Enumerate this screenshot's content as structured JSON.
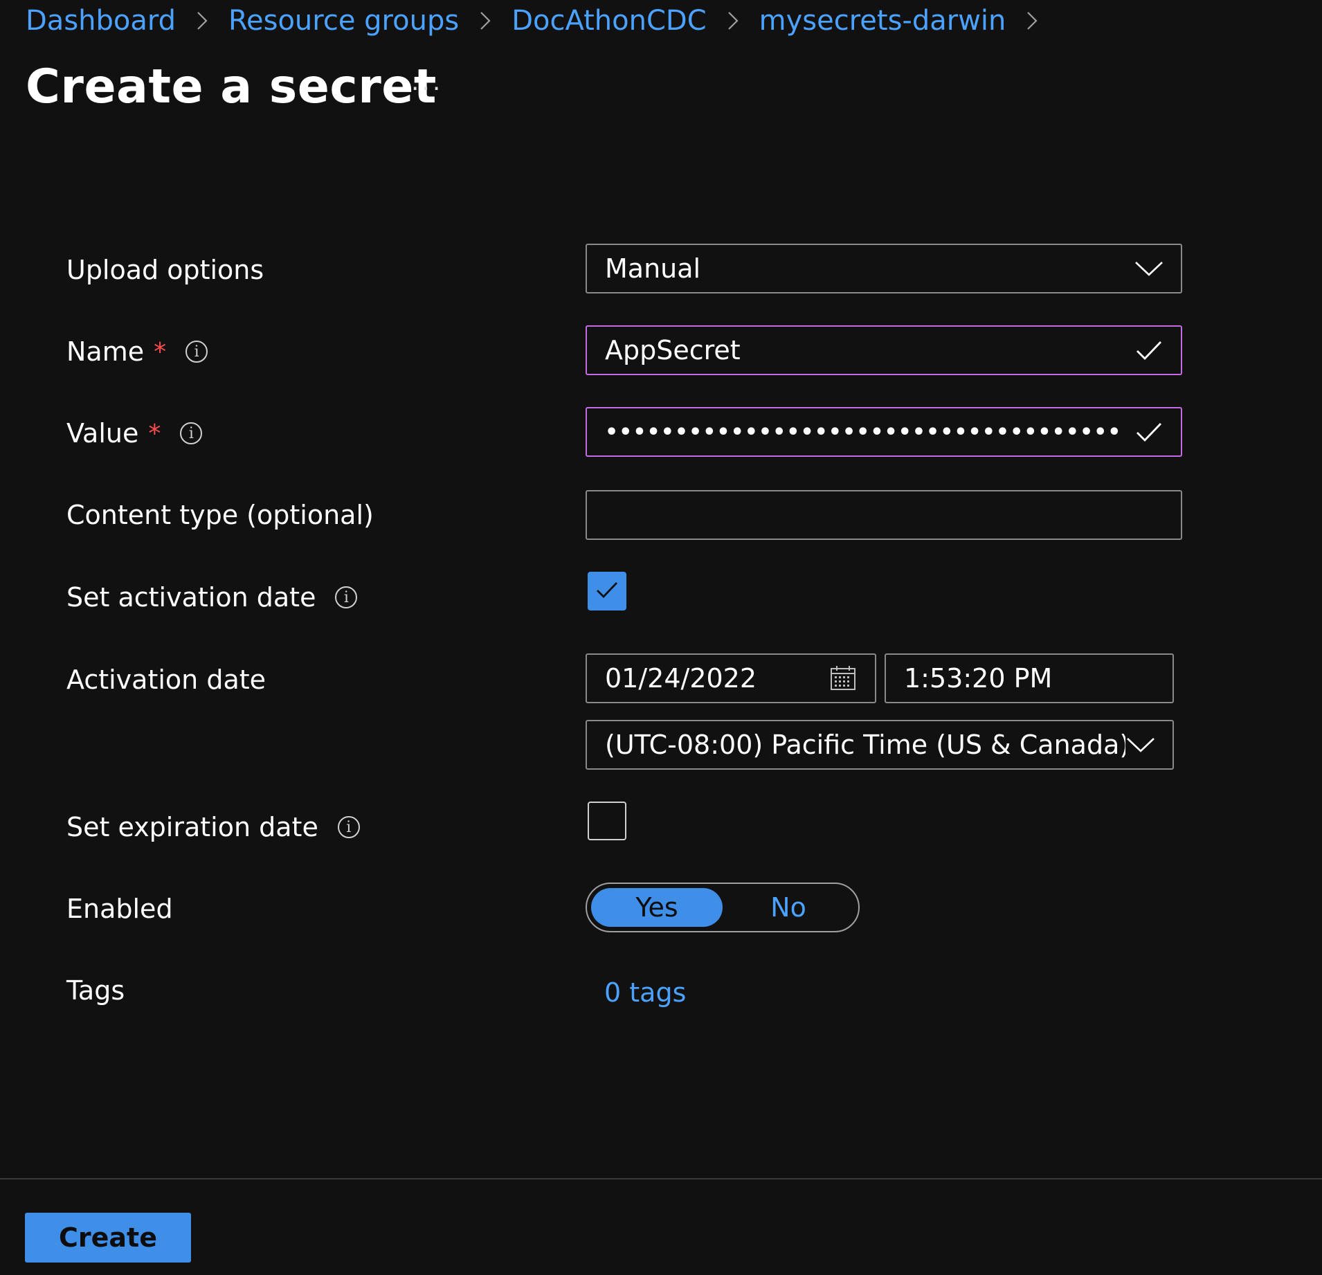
{
  "breadcrumb": {
    "items": [
      "Dashboard",
      "Resource groups",
      "DocAthonCDC",
      "mysecrets-darwin"
    ]
  },
  "page": {
    "title": "Create a secret",
    "more_label": "···"
  },
  "form": {
    "upload_options": {
      "label": "Upload options",
      "value": "Manual"
    },
    "name": {
      "label": "Name",
      "required_mark": "*",
      "value": "AppSecret"
    },
    "value": {
      "label": "Value",
      "required_mark": "*",
      "masked_value": "•••••••••••••••••••••••••••••••••••••"
    },
    "content_type": {
      "label": "Content type (optional)",
      "value": ""
    },
    "set_activation_date": {
      "label": "Set activation date",
      "checked": true
    },
    "activation_date": {
      "label": "Activation date",
      "date": "01/24/2022",
      "time": "1:53:20 PM",
      "timezone": "(UTC-08:00) Pacific Time (US & Canada)"
    },
    "set_expiration_date": {
      "label": "Set expiration date",
      "checked": false
    },
    "enabled": {
      "label": "Enabled",
      "yes": "Yes",
      "no": "No",
      "selected": "Yes"
    },
    "tags": {
      "label": "Tags",
      "link": "0 tags"
    }
  },
  "footer": {
    "create_label": "Create"
  },
  "colors": {
    "background": "#111111",
    "link": "#4ca3ff",
    "accent": "#3f8ee8",
    "valid_border": "#c36ce6",
    "required": "#ff4d4d"
  },
  "icons": {
    "info": "info-icon",
    "chevron": "chevron-down-icon",
    "check": "checkmark-icon",
    "calendar": "calendar-icon",
    "breadcrumb_separator": "chevron-right-icon"
  }
}
